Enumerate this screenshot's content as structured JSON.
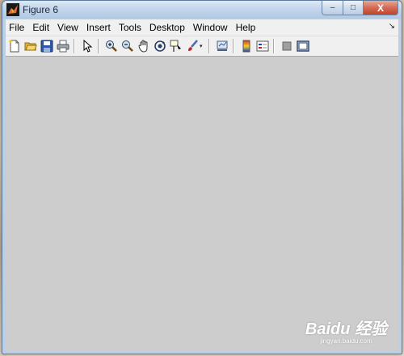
{
  "window": {
    "title": "Figure 6",
    "controls": {
      "minimize": "–",
      "maximize": "□",
      "close": "X"
    }
  },
  "menubar": {
    "items": [
      "File",
      "Edit",
      "View",
      "Insert",
      "Tools",
      "Desktop",
      "Window",
      "Help"
    ],
    "overflow_arrow": "↘"
  },
  "toolbar": {
    "buttons": [
      "new-figure-icon",
      "open-file-icon",
      "save-icon",
      "print-icon",
      "edit-plot-arrow-icon",
      "zoom-in-icon",
      "zoom-out-icon",
      "pan-hand-icon",
      "rotate-3d-icon",
      "data-cursor-icon",
      "brush-icon",
      "link-plot-icon",
      "colorbar-icon",
      "legend-icon",
      "hide-plot-tools-icon",
      "show-plot-tools-icon"
    ],
    "brush_dropdown": "▾"
  },
  "figure": {
    "background": "#cdcdcd"
  },
  "watermark": {
    "logo": "Baidu 经验",
    "url": "jingyan.baidu.com"
  },
  "colors": {
    "titlebar": "#c3d6ec",
    "menubar": "#f0f0f0",
    "canvas": "#cdcdcd"
  }
}
